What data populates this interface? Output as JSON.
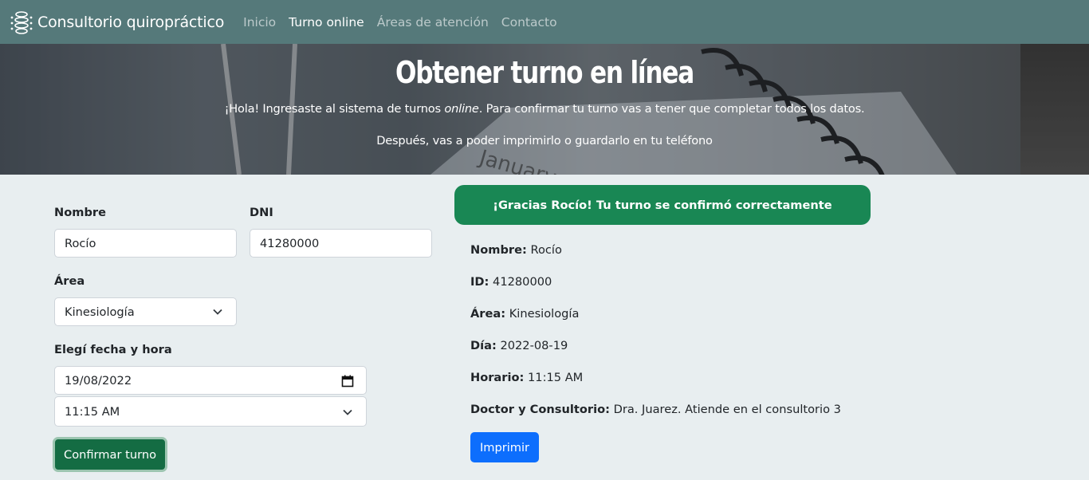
{
  "navbar": {
    "brand": "Consultorio quiropráctico",
    "brand_icon": "spine-icon",
    "links": [
      "Inicio",
      "Turno online",
      "Áreas de atención",
      "Contacto"
    ],
    "active": "Turno online",
    "bg_color": "#55797a"
  },
  "hero": {
    "title": "Obtener turno en línea",
    "line1_a": "¡Hola! Ingresaste al sistema de turnos ",
    "line1_em": "online",
    "line1_b": ". Para confirmar tu turno vas a tener que completar todos los datos.",
    "line2": "Después, vas a poder imprimirlo o guardarlo en tu teléfono"
  },
  "form": {
    "nombre_label": "Nombre",
    "nombre_value": "Rocío",
    "dni_label": "DNI",
    "dni_value": "41280000",
    "area_label": "Área",
    "area_value": "Kinesiología",
    "fecha_label": "Elegí fecha y hora",
    "fecha_value": "19/08/2022",
    "hora_value": "11:15 AM",
    "submit_label": "Confirmar turno"
  },
  "result": {
    "alert": "¡Gracias Rocío! Tu turno se confirmó correctamente",
    "alert_color": "#198754",
    "rows": [
      {
        "label": "Nombre:",
        "value": "Rocío"
      },
      {
        "label": "ID:",
        "value": "41280000"
      },
      {
        "label": "Área:",
        "value": "Kinesiología"
      },
      {
        "label": "Día:",
        "value": "2022-08-19"
      },
      {
        "label": "Horario:",
        "value": "11:15 AM"
      },
      {
        "label": "Doctor y Consultorio:",
        "value": "Dra. Juarez. Atiende en el consultorio 3"
      }
    ],
    "print_label": "Imprimir",
    "print_color": "#0d6efd"
  }
}
